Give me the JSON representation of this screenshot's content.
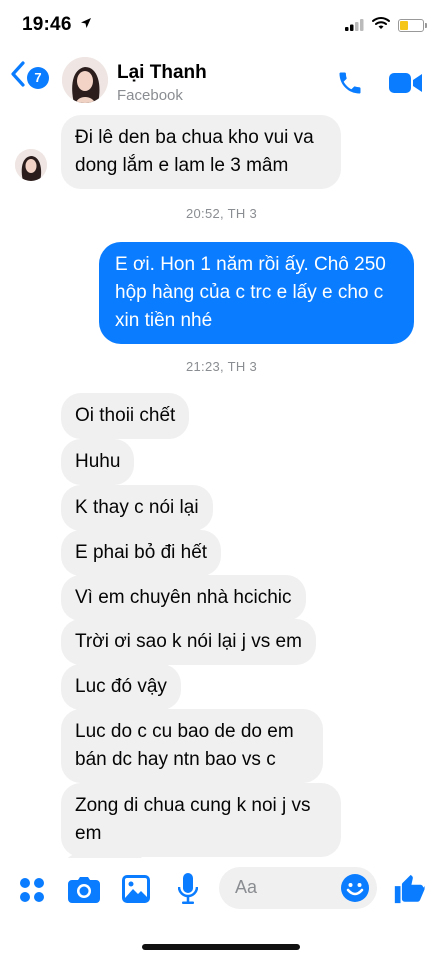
{
  "status_bar": {
    "time": "19:46"
  },
  "header": {
    "unread_count": "7",
    "contact_name": "Lại Thanh",
    "contact_subtitle": "Facebook"
  },
  "messages": [
    {
      "kind": "in",
      "lines": [
        "Đi lê den ba chua kho vui va",
        "dong lắm e lam le 3 mâm"
      ]
    },
    {
      "kind": "time",
      "text": "20:52, TH 3"
    },
    {
      "kind": "out",
      "lines": [
        "E ơi. Hon 1 năm rồi ấy. Chô 250",
        "hộp hàng của c trc e lấy e cho c",
        "xin tiền nhé"
      ]
    },
    {
      "kind": "time",
      "text": "21:23, TH 3"
    },
    {
      "kind": "in",
      "lines": [
        "Oi thoii chết"
      ]
    },
    {
      "kind": "in",
      "lines": [
        "Huhu"
      ]
    },
    {
      "kind": "in",
      "lines": [
        "K thay c nói lại"
      ]
    },
    {
      "kind": "in",
      "lines": [
        "E phai bỏ đi hết"
      ]
    },
    {
      "kind": "in",
      "lines": [
        "Vì em chuyên nhà hcichic"
      ]
    },
    {
      "kind": "in",
      "lines": [
        "Trời ơi sao k nói lại j vs em"
      ]
    },
    {
      "kind": "in",
      "lines": [
        "Luc đó vậy"
      ]
    },
    {
      "kind": "in",
      "lines": [
        "Luc do c cu bao de do em",
        "bán dc hay ntn bao vs c"
      ]
    },
    {
      "kind": "in",
      "lines": [
        "Zong di chua cung k noi j vs",
        "em"
      ]
    }
  ],
  "composer": {
    "placeholder": "Aa"
  },
  "colors": {
    "accent": "#0a7cff",
    "incoming_bubble": "#f0f0f0",
    "timestamp": "#8a8d91"
  },
  "icons": {
    "status": [
      "location-arrow-icon",
      "signal-bars-icon",
      "wifi-icon",
      "battery-icon"
    ],
    "header": [
      "back-chevron-icon",
      "phone-icon",
      "video-camera-icon"
    ],
    "composer": [
      "apps-grid-icon",
      "camera-icon",
      "gallery-icon",
      "microphone-icon",
      "emoji-icon",
      "thumbs-up-icon"
    ]
  }
}
